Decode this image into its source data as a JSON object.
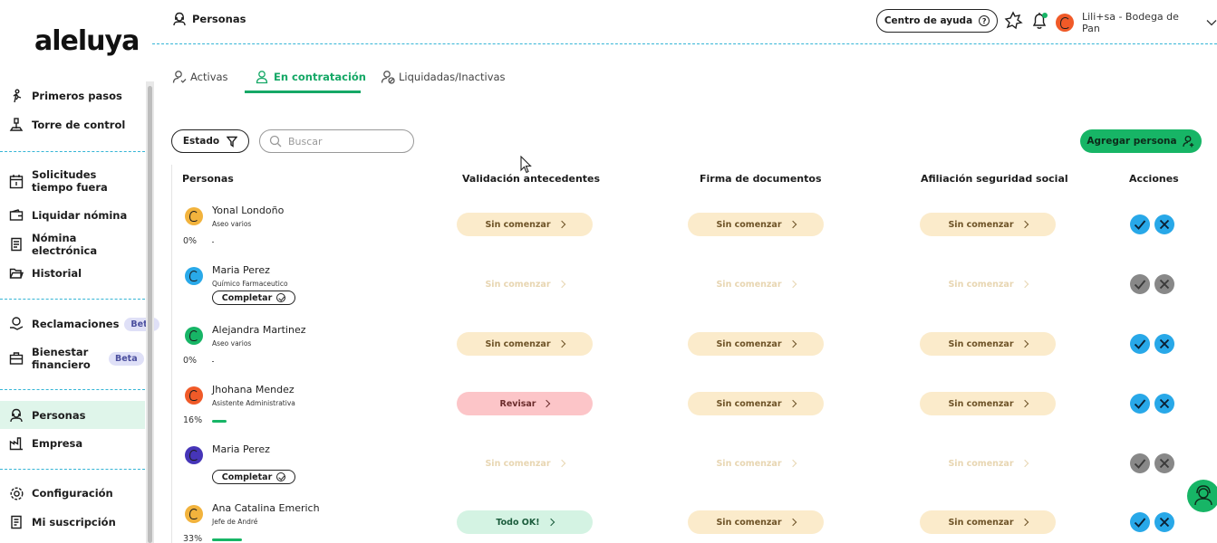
{
  "brand": {
    "logo_text": "aleluya"
  },
  "sidebar": {
    "items": [
      {
        "label": "Primeros pasos",
        "icon": "runner-icon"
      },
      {
        "label": "Torre de control",
        "icon": "control-tower-icon"
      },
      {
        "label": "Solicitudes tiempo fuera",
        "icon": "calendar-icon"
      },
      {
        "label": "Liquidar nómina",
        "icon": "wallet-icon"
      },
      {
        "label": "Nómina electrónica",
        "icon": "invoice-icon"
      },
      {
        "label": "Historial",
        "icon": "folder-icon"
      },
      {
        "label": "Reclamaciones",
        "icon": "money-hand-icon",
        "badge": "Beta"
      },
      {
        "label": "Bienestar financiero",
        "icon": "briefcase-icon",
        "badge": "Beta"
      },
      {
        "label": "Personas",
        "icon": "person-icon",
        "active": true
      },
      {
        "label": "Empresa",
        "icon": "factory-icon"
      },
      {
        "label": "Configuración",
        "icon": "gear-icon"
      },
      {
        "label": "Mi suscripción",
        "icon": "receipt-icon"
      }
    ]
  },
  "topbar": {
    "title": "Personas",
    "help_label": "Centro de ayuda",
    "help_icon_glyph": "?",
    "user_label": "Lili+sa - Bodega de Pan"
  },
  "tabs": [
    {
      "label": "Activas",
      "active": false
    },
    {
      "label": "En contratación",
      "active": true
    },
    {
      "label": "Liquidadas/Inactivas",
      "active": false
    }
  ],
  "filters": {
    "estado_label": "Estado",
    "search_placeholder": "Buscar",
    "add_label": "Agregar persona"
  },
  "table": {
    "headers": [
      "Personas",
      "Validación antecedentes",
      "Firma de documentos",
      "Afiliación seguridad social",
      "Acciones"
    ],
    "rows": [
      {
        "name": "Yonal Londoño",
        "role": "Aseo varios",
        "pct": "0%",
        "progress": 0,
        "avatar_color": "#f2b33d",
        "statuses": [
          {
            "label": "Sin comenzar",
            "kind": "pending"
          },
          {
            "label": "Sin comenzar",
            "kind": "pending"
          },
          {
            "label": "Sin comenzar",
            "kind": "pending"
          }
        ],
        "actions_enabled": true
      },
      {
        "name": "Maria Perez",
        "role": "Químico Farmaceutico",
        "complete_label": "Completar",
        "avatar_color": "#29a9e9",
        "statuses": [
          {
            "label": "Sin comenzar",
            "kind": "faded"
          },
          {
            "label": "Sin comenzar",
            "kind": "faded"
          },
          {
            "label": "Sin comenzar",
            "kind": "faded"
          }
        ],
        "actions_enabled": false
      },
      {
        "name": "Alejandra Martinez",
        "role": "Aseo varios",
        "pct": "0%",
        "progress": 0,
        "avatar_color": "#17b566",
        "statuses": [
          {
            "label": "Sin comenzar",
            "kind": "pending"
          },
          {
            "label": "Sin comenzar",
            "kind": "pending"
          },
          {
            "label": "Sin comenzar",
            "kind": "pending"
          }
        ],
        "actions_enabled": true
      },
      {
        "name": "Jhohana Mendez",
        "role": "Asistente Administrativa",
        "pct": "16%",
        "progress": 0.16,
        "avatar_color": "#f05a28",
        "statuses": [
          {
            "label": "Revisar",
            "kind": "review"
          },
          {
            "label": "Sin comenzar",
            "kind": "pending"
          },
          {
            "label": "Sin comenzar",
            "kind": "pending"
          }
        ],
        "actions_enabled": true
      },
      {
        "name": "Maria Perez",
        "role": "",
        "complete_label": "Completar",
        "avatar_color": "#4635b8",
        "statuses": [
          {
            "label": "Sin comenzar",
            "kind": "faded"
          },
          {
            "label": "Sin comenzar",
            "kind": "faded"
          },
          {
            "label": "Sin comenzar",
            "kind": "faded"
          }
        ],
        "actions_enabled": false
      },
      {
        "name": "Ana Catalina Emerich",
        "role": "Jefe de André",
        "pct": "33%",
        "progress": 0.33,
        "avatar_color": "#f2b33d",
        "statuses": [
          {
            "label": "Todo OK!",
            "kind": "ok"
          },
          {
            "label": "Sin comenzar",
            "kind": "pending"
          },
          {
            "label": "Sin comenzar",
            "kind": "pending"
          }
        ],
        "actions_enabled": true
      }
    ]
  }
}
